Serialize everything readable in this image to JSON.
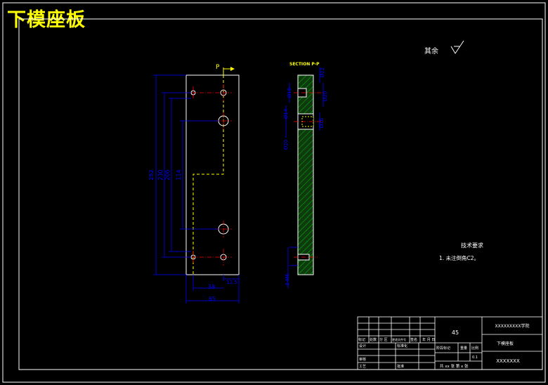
{
  "drawing": {
    "title": "下模座板",
    "colors": {
      "background": "#000000",
      "outline": "#ffffff",
      "dimension": "#0000ff",
      "centerline": "#ff0000",
      "hidden": "#ffff00",
      "hatch": "#00c000",
      "hatch_fill": "#0f3a0f",
      "annotation": "#ffff00",
      "text": "#ffffff"
    },
    "front_view": {
      "section_marker": "P",
      "dim_vertical": [
        "252",
        "230",
        "206",
        "114"
      ],
      "dim_bottom_small": "12.5",
      "dim_38": "38",
      "dim_width": "65"
    },
    "section_view": {
      "title": "SECTION  P-P",
      "dims": [
        "Ø16",
        "Ø14",
        "Ø20",
        "Ø22",
        "Ø20",
        "Ø16"
      ],
      "thread": "2-M6"
    },
    "surface_note": "其余",
    "tech_req": {
      "heading": "技术要求",
      "item": "1. 未注倒角C2。"
    },
    "title_block": {
      "material": "45",
      "school": "XXXXXXXXX学院",
      "part_name": "下模座板",
      "drawing_no": "XXXXXXX",
      "scale": "0.1",
      "sheet": "共 xx 张  第 x 张",
      "cells": [
        "标记",
        "处数",
        "分 区",
        "更改文件号",
        "签名",
        "年 月 日",
        "设计",
        "标准化",
        "阶段标记",
        "重量",
        "比例",
        "审核",
        "工艺",
        "批准"
      ]
    }
  }
}
